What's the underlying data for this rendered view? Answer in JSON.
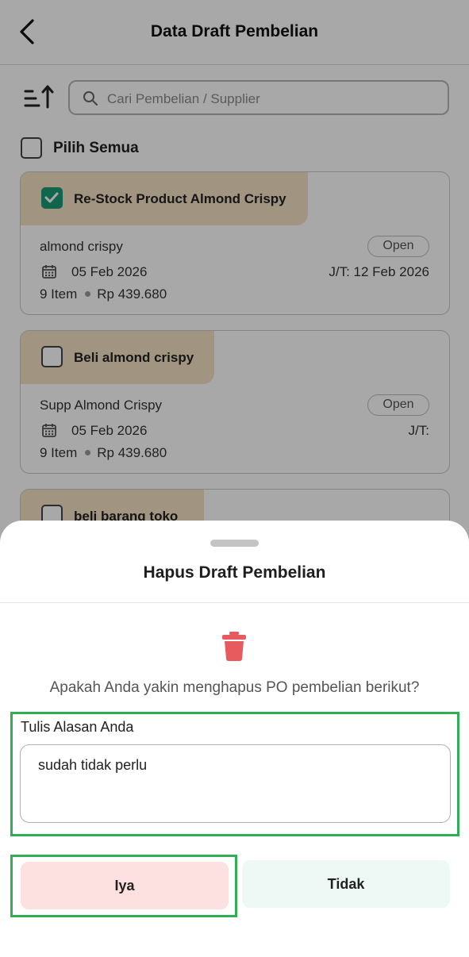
{
  "header": {
    "title": "Data Draft Pembelian"
  },
  "search": {
    "placeholder": "Cari Pembelian / Supplier"
  },
  "select_all": {
    "label": "Pilih Semua"
  },
  "cards": [
    {
      "title": "Re-Stock Product Almond Crispy",
      "checked": true,
      "supplier": "almond crispy",
      "status": "Open",
      "date": "05 Feb 2026",
      "due": "J/T: 12 Feb 2026",
      "items": "9 Item",
      "amount": "Rp 439.680"
    },
    {
      "title": "Beli almond crispy",
      "checked": false,
      "supplier": "Supp Almond Crispy",
      "status": "Open",
      "date": "05 Feb 2026",
      "due": "J/T:",
      "items": "9 Item",
      "amount": "Rp 439.680"
    },
    {
      "title": "beli barang toko",
      "checked": false
    }
  ],
  "sheet": {
    "title": "Hapus Draft Pembelian",
    "confirm_text": "Apakah Anda yakin menghapus PO pembelian berikut?",
    "reason_label": "Tulis Alasan Anda",
    "reason_value": "sudah tidak perlu",
    "yes_label": "Iya",
    "no_label": "Tidak"
  },
  "icons": {
    "back": "chevron-left-icon",
    "sort": "sort-icon",
    "search": "search-icon",
    "calendar": "calendar-icon",
    "trash": "trash-icon"
  },
  "colors": {
    "accent_green": "#1a9a76",
    "card_tab": "#f5e2c5",
    "danger": "#e75b5f",
    "yes_bg": "#fde0e0",
    "no_bg": "#eef9f5",
    "highlight": "#2fae55"
  }
}
